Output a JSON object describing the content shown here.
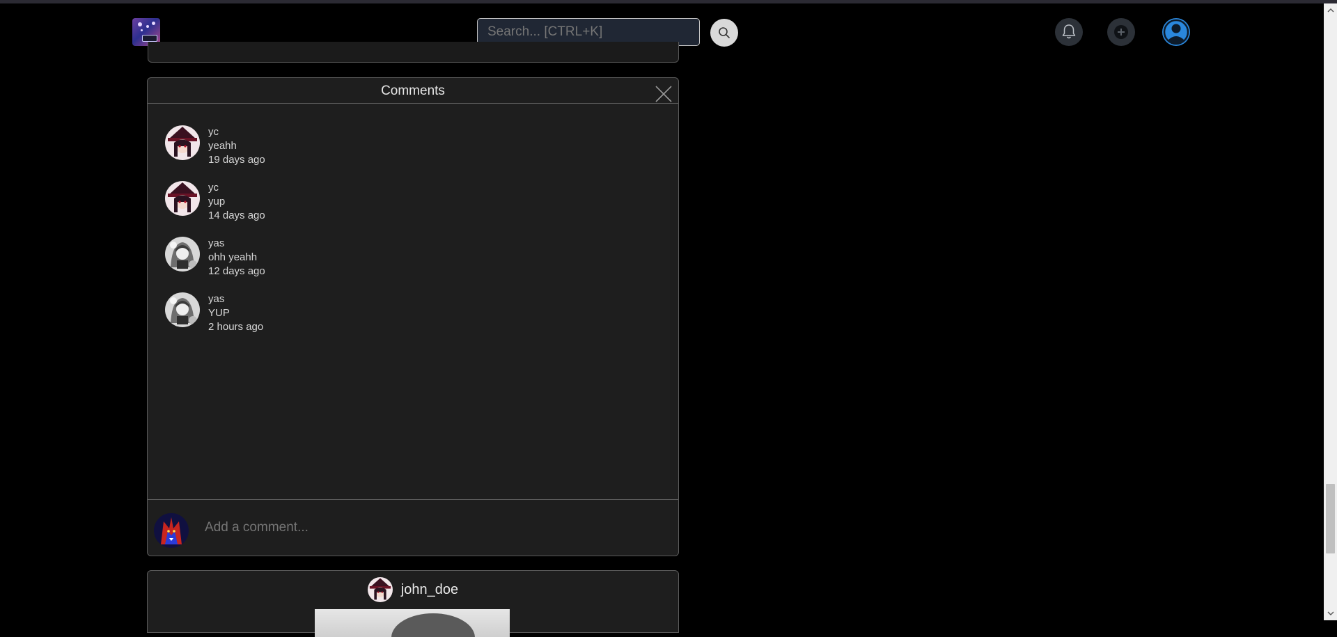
{
  "header": {
    "logo_icon": "site-logo",
    "search_placeholder": "Search... [CTRL+K]",
    "search_button_icon": "search-icon",
    "notifications_icon": "bell-icon",
    "create_icon": "plus-circle-icon",
    "profile_icon": "user-icon"
  },
  "comments": {
    "title": "Comments",
    "close_icon": "close-icon",
    "items": [
      {
        "user": "yc",
        "text": "yeahh",
        "time": "19 days ago",
        "avatar": "anime-girl-witch-hat"
      },
      {
        "user": "yc",
        "text": "yup",
        "time": "14 days ago",
        "avatar": "anime-girl-witch-hat"
      },
      {
        "user": "yas",
        "text": "ohh yeahh",
        "time": "12 days ago",
        "avatar": "monochrome-anime"
      },
      {
        "user": "yas",
        "text": "YUP",
        "time": "2 hours ago",
        "avatar": "monochrome-anime"
      }
    ],
    "composer": {
      "placeholder": "Add a comment...",
      "avatar": "red-blue-wolf"
    }
  },
  "next_post": {
    "author": "john_doe"
  },
  "colors": {
    "background": "#000000",
    "panel": "#1e1e1e",
    "border": "#5a5a5a",
    "profile_accent": "#2a87dc"
  }
}
